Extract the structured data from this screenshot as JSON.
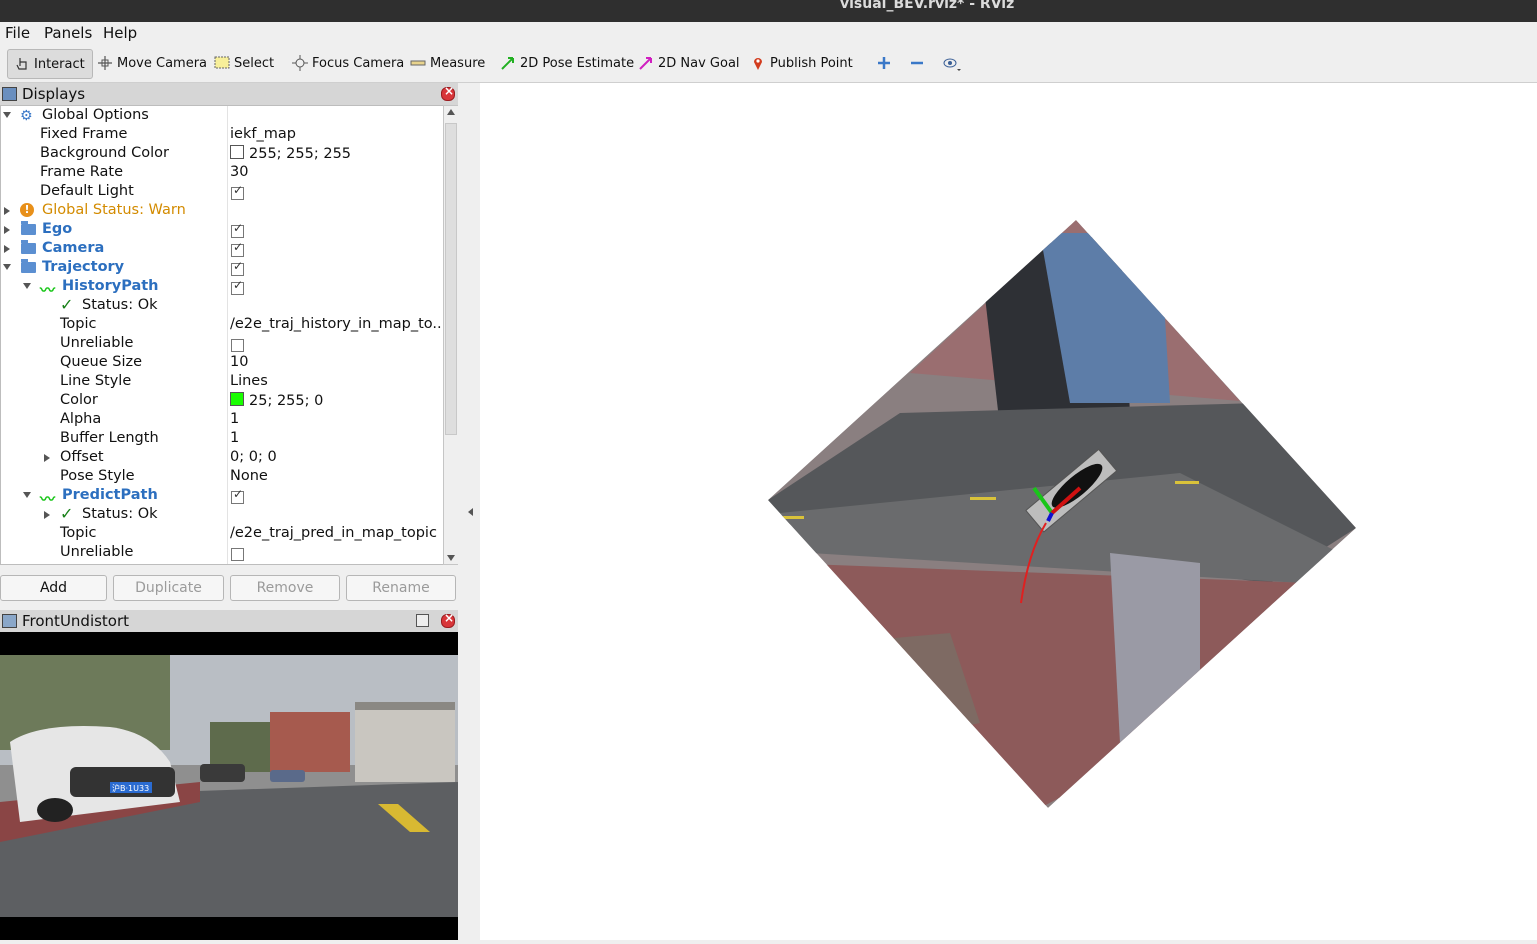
{
  "window": {
    "title": "visual_BEV.rviz* - RViz"
  },
  "menu": {
    "file": "File",
    "panels": "Panels",
    "help": "Help"
  },
  "toolbar": {
    "interact": "Interact",
    "move_camera": "Move Camera",
    "select": "Select",
    "focus_camera": "Focus Camera",
    "measure": "Measure",
    "pose_estimate": "2D Pose Estimate",
    "nav_goal": "2D Nav Goal",
    "publish_point": "Publish Point"
  },
  "displays": {
    "title": "Displays",
    "rows": {
      "global_options": "Global Options",
      "fixed_frame": {
        "name": "Fixed Frame",
        "value": "iekf_map"
      },
      "background_color": {
        "name": "Background Color",
        "value": "255; 255; 255"
      },
      "frame_rate": {
        "name": "Frame Rate",
        "value": "30"
      },
      "default_light": {
        "name": "Default Light"
      },
      "global_status": "Global Status: Warn",
      "ego": "Ego",
      "camera": "Camera",
      "trajectory": "Trajectory",
      "history_path": "HistoryPath",
      "history_status": "Status: Ok",
      "topic": {
        "name": "Topic",
        "value": "/e2e_traj_history_in_map_to..."
      },
      "unreliable": {
        "name": "Unreliable"
      },
      "queue_size": {
        "name": "Queue Size",
        "value": "10"
      },
      "line_style": {
        "name": "Line Style",
        "value": "Lines"
      },
      "color": {
        "name": "Color",
        "value": "25; 255; 0"
      },
      "alpha": {
        "name": "Alpha",
        "value": "1"
      },
      "buffer_length": {
        "name": "Buffer Length",
        "value": "1"
      },
      "offset": {
        "name": "Offset",
        "value": "0; 0; 0"
      },
      "pose_style": {
        "name": "Pose Style",
        "value": "None"
      },
      "predict_path": "PredictPath",
      "predict_status": "Status: Ok",
      "predict_topic": {
        "name": "Topic",
        "value": "/e2e_traj_pred_in_map_topic"
      },
      "predict_unreliable": {
        "name": "Unreliable"
      }
    },
    "buttons": {
      "add": "Add",
      "duplicate": "Duplicate",
      "remove": "Remove",
      "rename": "Rename"
    }
  },
  "camera_panel": {
    "title": "FrontUndistort",
    "plate": "沪B·1U33"
  },
  "colors": {
    "history_path": "#19ff00",
    "background": "#ffffff",
    "warn": "#d38b00",
    "link": "#2c6fbf"
  }
}
